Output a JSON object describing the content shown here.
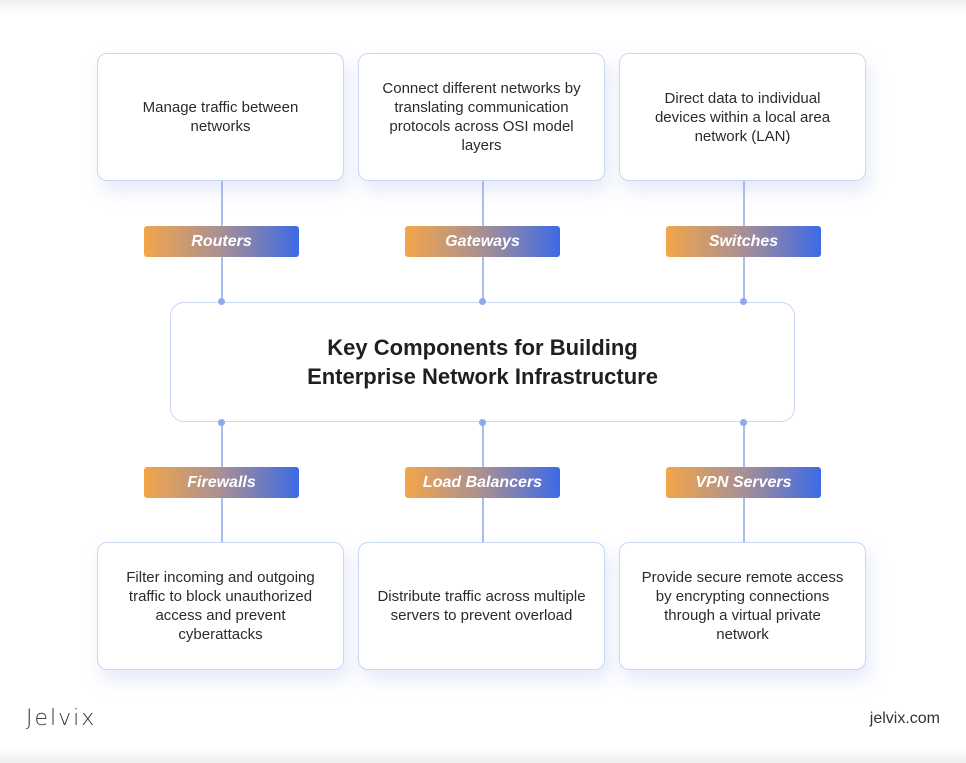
{
  "title_line1": "Key Components for Building",
  "title_line2": "Enterprise Network Infrastructure",
  "colors": {
    "gradient_start": "#f2a64a",
    "gradient_end": "#3d6ae6",
    "connector": "#a9bdf0",
    "card_border": "#c9d6f5"
  },
  "top_components": [
    {
      "label": "Routers",
      "description": "Manage traffic between networks"
    },
    {
      "label": "Gateways",
      "description": "Connect different networks by translating communication protocols across OSI model layers"
    },
    {
      "label": "Switches",
      "description": "Direct data to individual devices within a local area network (LAN)"
    }
  ],
  "bottom_components": [
    {
      "label": "Firewalls",
      "description": "Filter incoming and outgoing traffic to block unauthorized access and prevent cyberattacks"
    },
    {
      "label": "Load Balancers",
      "description": "Distribute traffic across multiple servers to prevent overload"
    },
    {
      "label": "VPN Servers",
      "description": "Provide secure remote access by encrypting connections through a virtual private network"
    }
  ],
  "footer": {
    "logo": "Jelvix",
    "website": "jelvix.com"
  }
}
